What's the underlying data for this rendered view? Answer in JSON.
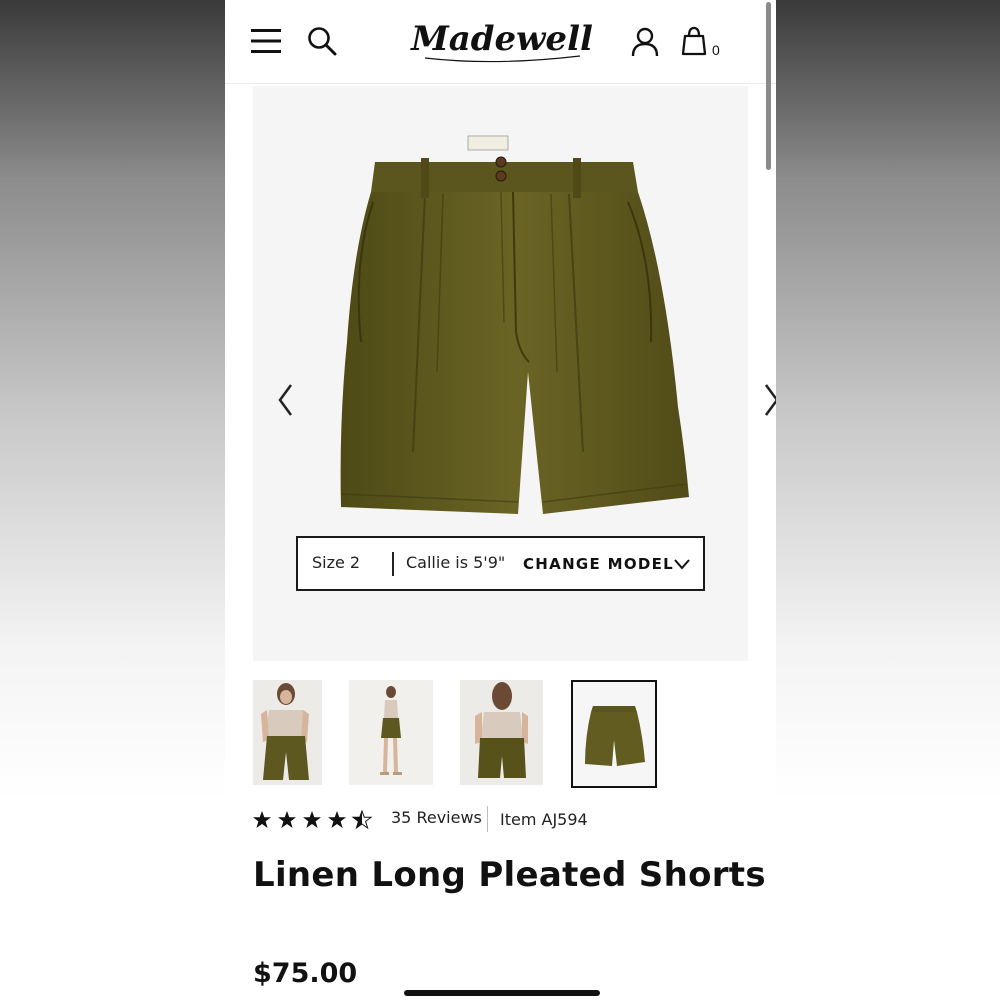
{
  "header": {
    "logo_text": "Madewell",
    "icons": [
      "menu-icon",
      "search-icon",
      "account-icon",
      "bag-icon"
    ],
    "bag_count": "0"
  },
  "product_image": {
    "alt": "Linen Long Pleated Shorts",
    "color": "#5f5a1e",
    "model_info": {
      "size": "Size 2",
      "model": "Callie is 5'9\"",
      "change_label": "CHANGE MODEL"
    }
  },
  "thumbnails": [
    "front-model",
    "side-model",
    "back-model",
    "flat-lay"
  ],
  "reviews": {
    "rating": 4.5,
    "max": 5,
    "count_label": "35 Reviews"
  },
  "item_number": "Item AJ594",
  "product_title": "Linen Long Pleated Shorts",
  "price": "$75.00"
}
